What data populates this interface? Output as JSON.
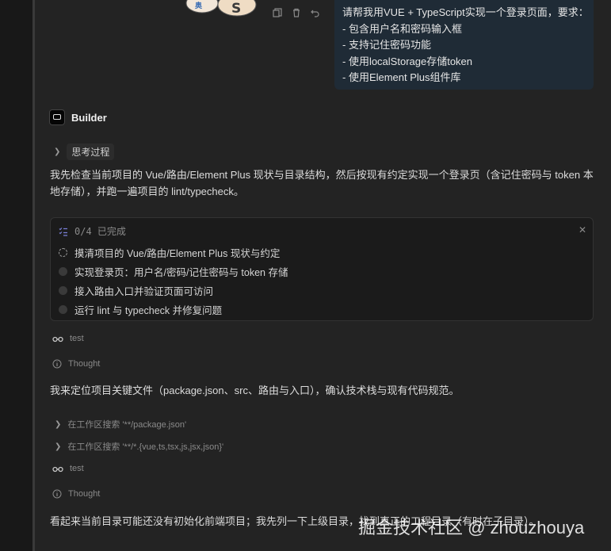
{
  "user_message": {
    "lines": [
      "请帮我用VUE + TypeScript实现一个登录页面，要求：",
      "- 包含用户名和密码输入框",
      "- 支持记住密码功能",
      "- 使用localStorage存储token",
      "- 使用Element Plus组件库"
    ]
  },
  "builder": {
    "name": "Builder"
  },
  "thinking": {
    "label": "思考过程"
  },
  "intro": "我先检查当前项目的 Vue/路由/Element Plus 现状与目录结构，然后按现有约定实现一个登录页（含记住密码与 token 本地存储），并跑一遍项目的 lint/typecheck。",
  "todo": {
    "progress": "0/4 已完成",
    "items": [
      {
        "label": "摸清项目的 Vue/路由/Element Plus 现状与约定",
        "status": "in_progress"
      },
      {
        "label": "实现登录页：用户名/密码/记住密码与 token 存储",
        "status": "todo"
      },
      {
        "label": "接入路由入口并验证页面可访问",
        "status": "todo"
      },
      {
        "label": "运行 lint 与 typecheck 并修复问题",
        "status": "todo"
      }
    ]
  },
  "timeline": {
    "test1": "test",
    "thought1": "Thought",
    "para2": "我来定位项目关键文件（package.json、src、路由与入口），确认技术栈与现有代码规范。",
    "search1": "在工作区搜索 '**/package.json'",
    "search2": "在工作区搜索 '**/*.{vue,ts,tsx,js,jsx,json}'",
    "test2": "test",
    "thought2": "Thought",
    "para3": "看起来当前目录可能还没有初始化前端项目；我先列一下上级目录，找到真正的工程目录（有时在子目录）。"
  },
  "watermark": "掘金技术社区 @ zhouzhouya",
  "colors": {
    "bubble": "#1f2b36",
    "panel": "#232323",
    "text": "#dcdcdc"
  }
}
